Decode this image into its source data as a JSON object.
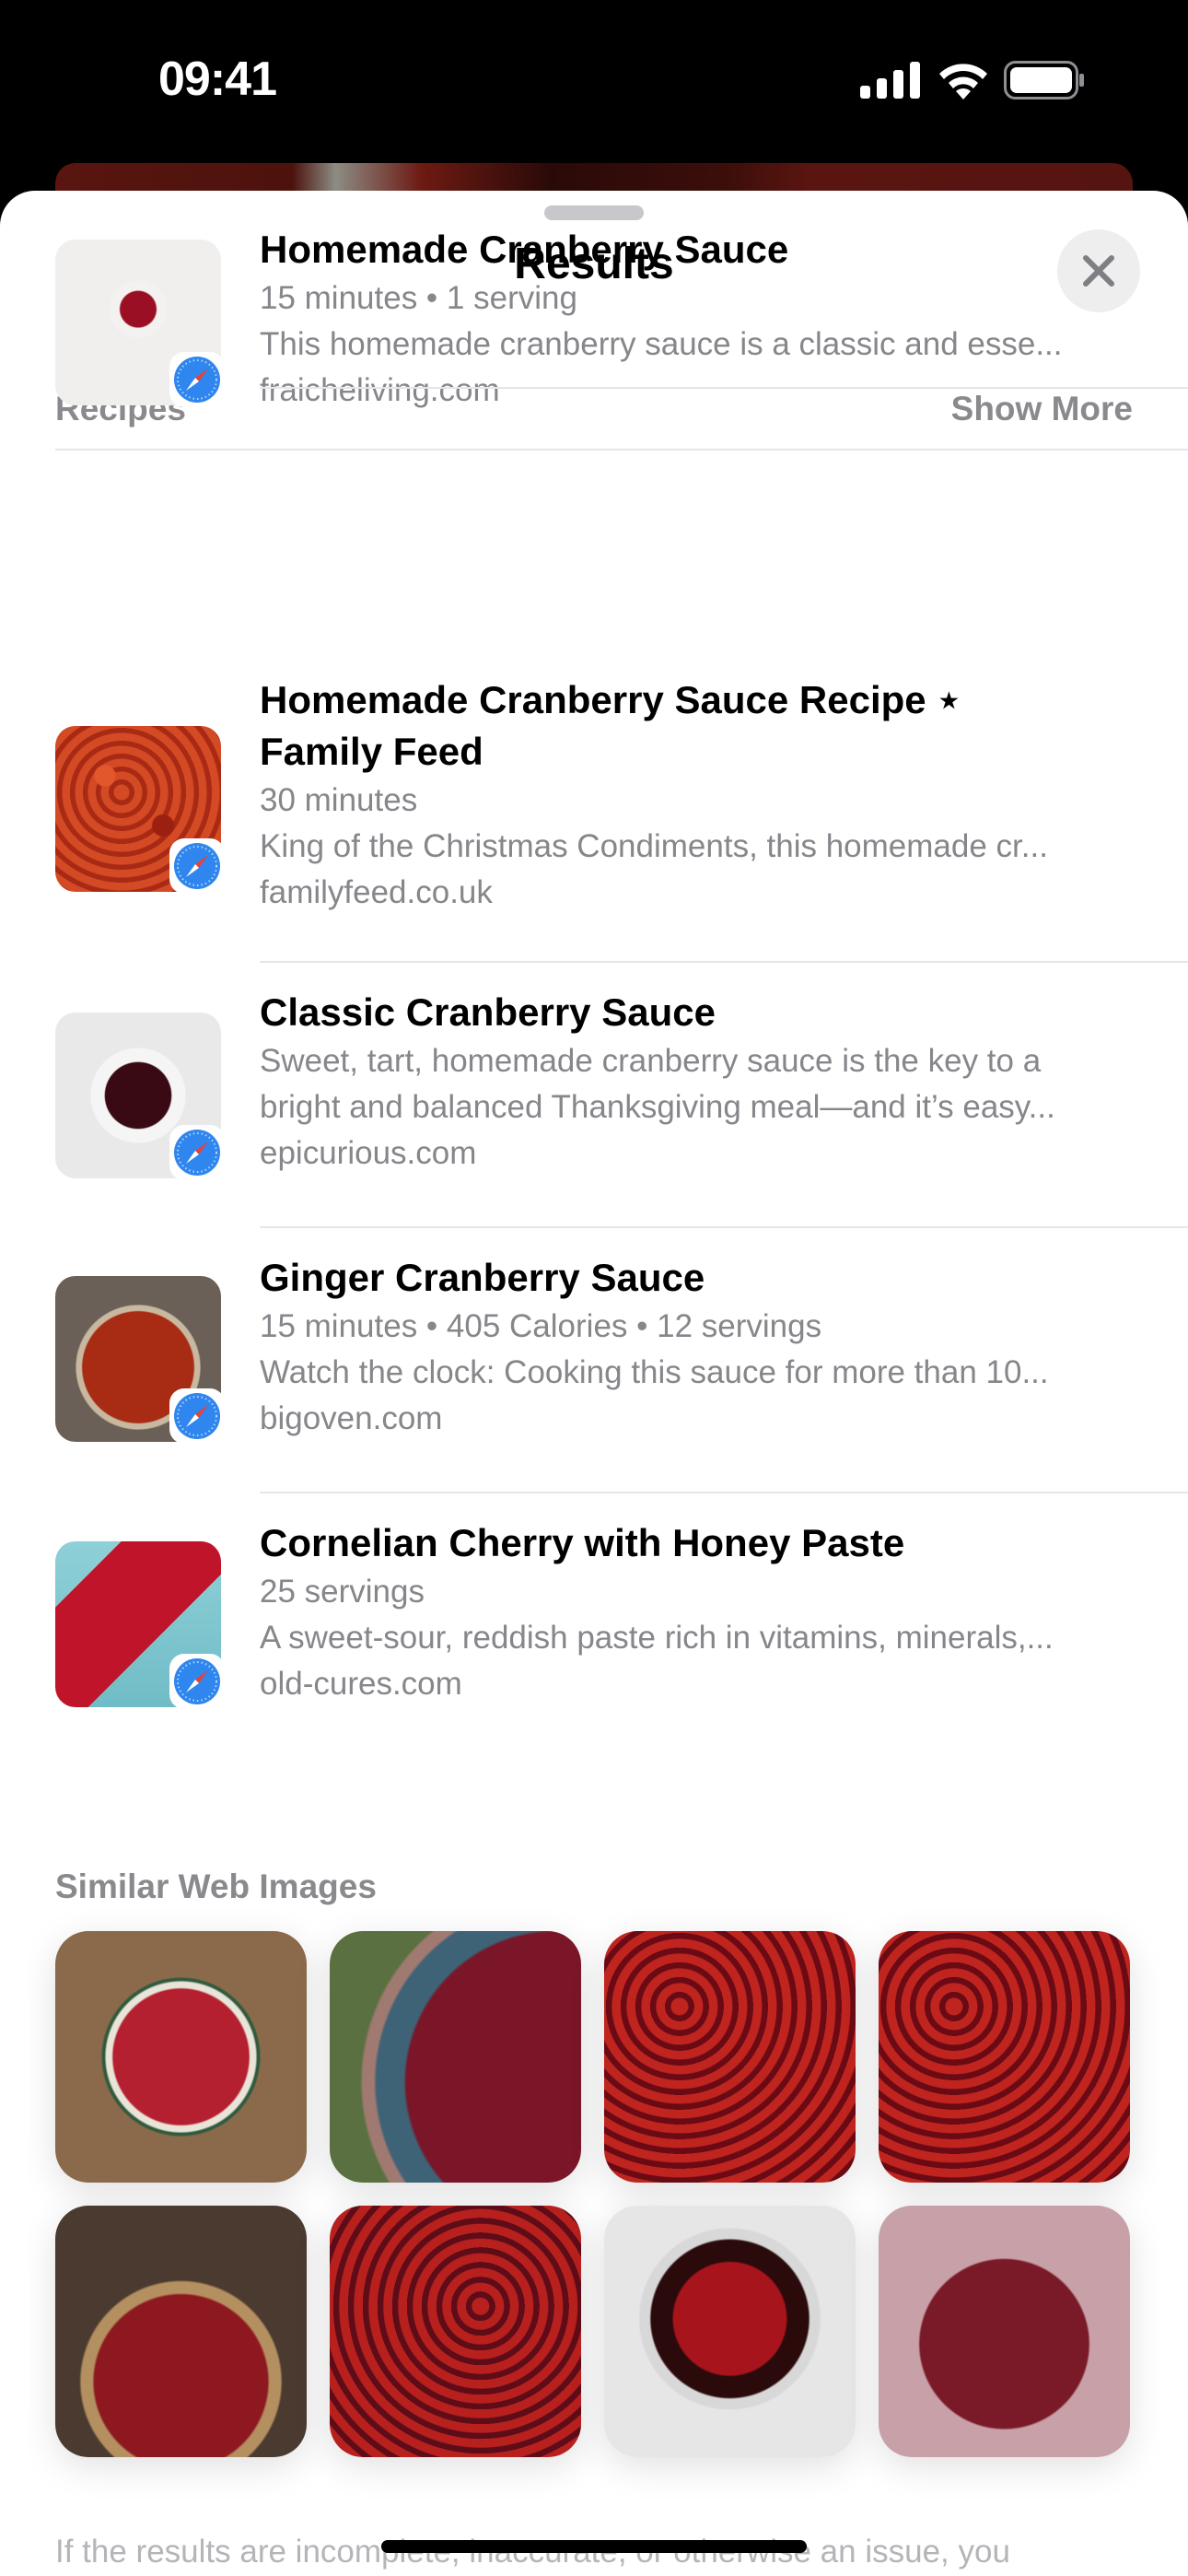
{
  "status_bar": {
    "time": "09:41",
    "icons": [
      "cellular-signal-icon",
      "wifi-icon",
      "battery-icon"
    ]
  },
  "sheet": {
    "title": "Results",
    "close_icon": "close-icon"
  },
  "recipes": {
    "section_label": "Recipes",
    "show_more_label": "Show More",
    "items": [
      {
        "title": "Homemade Cranberry Sauce",
        "meta": "15 minutes • 1 serving",
        "description": "This homemade cranberry sauce is a classic and esse...",
        "source": "fraicheliving.com",
        "thumb_colors": [
          "#f2f0ee",
          "#b3122a"
        ]
      },
      {
        "title": "Homemade Cranberry Sauce Recipe ⋆ Family Feed",
        "meta": "30 minutes",
        "description": "King of the Christmas Condiments, this homemade cr...",
        "source": "familyfeed.co.uk",
        "thumb_colors": [
          "#c8361c",
          "#e05a2a"
        ]
      },
      {
        "title": "Classic Cranberry Sauce",
        "meta": "",
        "description": "Sweet, tart, homemade cranberry sauce is the key to a bright and balanced Thanksgiving meal—and it’s easy...",
        "description_lines": [
          "Sweet, tart, homemade cranberry sauce is the key to a",
          "bright and balanced Thanksgiving meal—and it’s easy..."
        ],
        "source": "epicurious.com",
        "thumb_colors": [
          "#ededed",
          "#3a0a14"
        ]
      },
      {
        "title": "Ginger Cranberry Sauce",
        "meta": "15 minutes • 405 Calories • 12 servings",
        "description": "Watch the clock: Cooking this sauce for more than 10...",
        "source": "bigoven.com",
        "thumb_colors": [
          "#8c2a12",
          "#b23a18"
        ]
      },
      {
        "title": "Cornelian Cherry with Honey Paste",
        "meta": "25 servings",
        "description": "A sweet-sour, reddish paste rich in vitamins, minerals,...",
        "source": "old-cures.com",
        "thumb_colors": [
          "#7ec6cf",
          "#c0142a"
        ]
      }
    ]
  },
  "similar_images": {
    "section_label": "Similar Web Images",
    "images": [
      {
        "alt": "cranberries in colander on wood",
        "colors": [
          "#8a6a4a",
          "#b52030"
        ]
      },
      {
        "alt": "cranberries in blue bowl",
        "colors": [
          "#5a7040",
          "#7a1628"
        ]
      },
      {
        "alt": "pile of cranberries",
        "colors": [
          "#7a0e14",
          "#c0241e"
        ]
      },
      {
        "alt": "pile of cranberries",
        "colors": [
          "#7a0e14",
          "#c0241e"
        ]
      },
      {
        "alt": "hands holding cranberries over basket",
        "colors": [
          "#4a3a30",
          "#8e1820"
        ]
      },
      {
        "alt": "pile of cranberries",
        "colors": [
          "#6e0e18",
          "#b8201e"
        ]
      },
      {
        "alt": "cranberries in pot with spoon",
        "colors": [
          "#dedede",
          "#a8141c"
        ]
      },
      {
        "alt": "cornelian cherries in bag",
        "colors": [
          "#c8a0a8",
          "#7a1a28"
        ]
      }
    ]
  },
  "footer_note": "If the results are incomplete, inaccurate, or otherwise an issue, you"
}
